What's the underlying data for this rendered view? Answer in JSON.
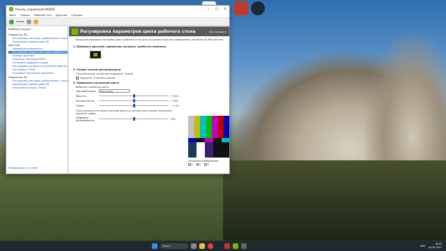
{
  "window": {
    "title": "Панель управления NVIDIA",
    "menu": [
      "Файл",
      "Правка",
      "Рабочий стол",
      "Дисплей",
      "Справка"
    ],
    "back_label": "Назад"
  },
  "tasks": {
    "header": "Выберите задачу...",
    "categories": [
      {
        "label": "Параметры 3D",
        "items": [
          "Регулировка настроек изображения с просмотром",
          "Управление параметрами 3D"
        ]
      },
      {
        "label": "Дисплей",
        "items": [
          "Изменение разрешения",
          "Регулировка параметров цвета рабочего стола",
          "Поворот дисплея",
          "Просмотр состояния HDCP",
          "Установка цифрового аудио",
          "Регулировка размера и положения рабочего стола",
          "Настройка G-SYNC",
          "Установка нескольких дисплеев"
        ]
      },
      {
        "label": "Параметры 3D",
        "items": [
          "Регулировка настроек изображения с просмотром",
          "Управление параметрами 3D",
          "Настройка Surround, PhysX"
        ]
      }
    ],
    "selected": "Регулировка параметров цвета рабочего стола",
    "system_info": "Информация о системе"
  },
  "content": {
    "title": "Регулировка параметров цвета рабочего стола",
    "restore": "Восстановить",
    "description": "Можно регулировать настройки цвета рабочего стола для улучшения качества изображения, например на ЖК-дисплее",
    "section1": "1. Выберите дисплей, параметры которого требуется изменить.",
    "section2": "2. Режим точной цветопередачи",
    "section2_text": "Текущий режим точной цветопередачи: Точный",
    "section2_check": "Приоритет отличного режима",
    "section3": "3. Примените улучшения цвета",
    "color_settings_label": "Выберите параметры цвета",
    "channel_label": "Цветовой канал:",
    "channel_value": "Все каналы",
    "brightness_label": "Яркость:",
    "brightness_value": "+ 50%",
    "contrast_label": "Контрастность:",
    "contrast_value": "+ 50%",
    "gamma_label": "Гамма:",
    "gamma_value": "+ 1.00",
    "note": "Очень высокие или низкие значения яркости и контрастности может ограничить диапазон гаммы.",
    "vibrance_label": "Цифровая интенсивность:",
    "vibrance_value": "50%",
    "reference_label": "Эталонное изображение:",
    "reference_options": [
      "1",
      "2",
      "3"
    ]
  },
  "taskbar": {
    "search_placeholder": "Поиск",
    "lang": "ENG",
    "time": "18:09",
    "date": "26.10.2023"
  },
  "colors": {
    "nvidia_green": "#76b900",
    "link_blue": "#1b57b5",
    "selection": "#3a87d8"
  },
  "levels": {
    "brightness_fraction": 0.5,
    "contrast_fraction": 0.5,
    "gamma_fraction": 0.5,
    "vibrance_fraction": 0.5
  }
}
